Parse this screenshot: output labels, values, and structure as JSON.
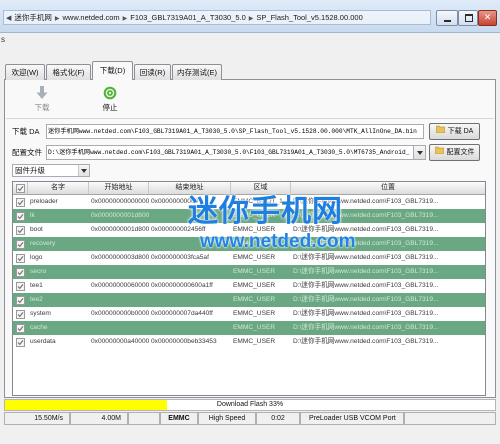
{
  "window": {
    "breadcrumb": [
      "迷你手机网",
      "www.netded.com",
      "F103_GBL7319A01_A_T3030_5.0",
      "SP_Flash_Tool_v5.1528.00.000"
    ],
    "left_fragment": "s"
  },
  "tabs": [
    {
      "label": "欢迎(W)"
    },
    {
      "label": "格式化(F)"
    },
    {
      "label": "下载(D)"
    },
    {
      "label": "回读(R)"
    },
    {
      "label": "内存测试(E)"
    }
  ],
  "toolbar": {
    "download_label": "下载",
    "download_icon": "download-arrow-icon",
    "stop_label": "停止",
    "stop_icon": "stop-circle-icon"
  },
  "da": {
    "label": "下载 DA",
    "value": "迷你手机网www.netded.com\\F103_GBL7319A01_A_T3030_5.0\\SP_Flash_Tool_v5.1528.00.000\\MTK_AllInOne_DA.bin",
    "button": "下载 DA"
  },
  "scatter": {
    "label": "配置文件",
    "value": "D:\\迷你手机网www.netded.com\\F103_GBL7319A01_A_T3030_5.0\\F103_GBL7319A01_A_T3030_5.0\\MT6735_Android_",
    "button": "配置文件"
  },
  "mode": {
    "value": "固件升级"
  },
  "table": {
    "columns": [
      "名字",
      "开始地址",
      "结束地址",
      "区域",
      "位置"
    ],
    "rows": [
      {
        "checked": true,
        "highlighted": false,
        "name": "preloader",
        "start": "0x0000000000000000",
        "end": "0x00000000000",
        "region": "EMMC_BOOT_1",
        "location": "D:\\迷你手机网www.netded.com\\F103_GBL7319..."
      },
      {
        "checked": true,
        "highlighted": true,
        "name": "lk",
        "start": "0x0000000001d8000",
        "end": "",
        "region": "EMMC_USER",
        "location": "D:\\迷你手机网www.netded.com\\F103_GBL7319..."
      },
      {
        "checked": true,
        "highlighted": false,
        "name": "boot",
        "start": "0x0000000001d80000",
        "end": "0x000000002456ff",
        "region": "EMMC_USER",
        "location": "D:\\迷你手机网www.netded.com\\F103_GBL7319..."
      },
      {
        "checked": true,
        "highlighted": true,
        "name": "recovery",
        "start": "",
        "end": "",
        "region": "EMMC_USER",
        "location": "D:\\迷你手机网www.netded.com\\F103_GBL7319..."
      },
      {
        "checked": true,
        "highlighted": false,
        "name": "logo",
        "start": "0x0000000003d80000",
        "end": "0x000000003fca5af",
        "region": "EMMC_USER",
        "location": "D:\\迷你手机网www.netded.com\\F103_GBL7319..."
      },
      {
        "checked": true,
        "highlighted": true,
        "name": "secro",
        "start": "",
        "end": "",
        "region": "EMMC_USER",
        "location": "D:\\迷你手机网www.netded.com\\F103_GBL7319..."
      },
      {
        "checked": true,
        "highlighted": false,
        "name": "tee1",
        "start": "0x0000000006000000",
        "end": "0x000000000600a1ff",
        "region": "EMMC_USER",
        "location": "D:\\迷你手机网www.netded.com\\F103_GBL7319..."
      },
      {
        "checked": true,
        "highlighted": true,
        "name": "tee2",
        "start": "",
        "end": "",
        "region": "EMMC_USER",
        "location": "D:\\迷你手机网www.netded.com\\F103_GBL7319..."
      },
      {
        "checked": true,
        "highlighted": false,
        "name": "system",
        "start": "0x000000000b000000",
        "end": "0x000000007da440ff",
        "region": "EMMC_USER",
        "location": "D:\\迷你手机网www.netded.com\\F103_GBL7319..."
      },
      {
        "checked": true,
        "highlighted": true,
        "name": "cache",
        "start": "",
        "end": "",
        "region": "EMMC_USER",
        "location": "D:\\迷你手机网www.netded.com\\F103_GBL7319..."
      },
      {
        "checked": true,
        "highlighted": false,
        "name": "userdata",
        "start": "0x00000000a4000000",
        "end": "0x00000000beb33453",
        "region": "EMMC_USER",
        "location": "D:\\迷你手机网www.netded.com\\F103_GBL7319..."
      }
    ]
  },
  "watermark": {
    "title": "迷你手机网",
    "url": "www.netded.com"
  },
  "progress": {
    "text": "Download Flash 33%",
    "percent": 33
  },
  "status": {
    "speed": "15.50M/s",
    "size": "4.00M",
    "storage": "EMMC",
    "usb_mode": "High Speed",
    "elapsed": "0:02",
    "port": "PreLoader USB VCOM Port"
  },
  "colors": {
    "row_highlight": "#6aa883",
    "progress_fill": "#ffff00",
    "watermark": "#1f7fe0",
    "close_button": "#c7442f",
    "stop_icon": "#4fb236"
  }
}
